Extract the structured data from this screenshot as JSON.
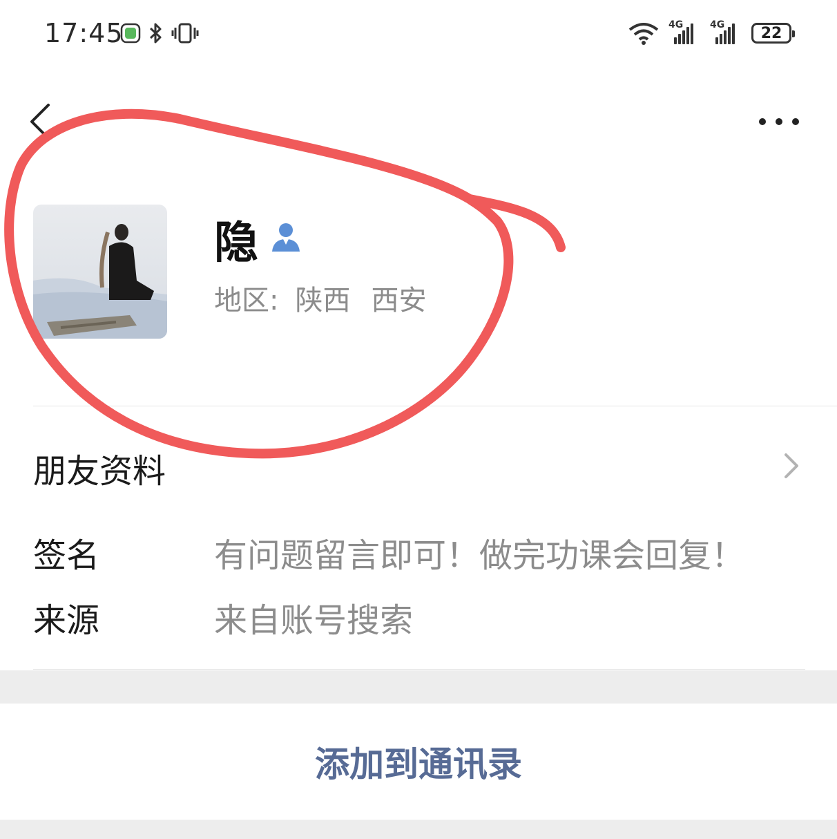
{
  "status_bar": {
    "time": "17:45",
    "battery": "22",
    "network_label_1": "4G",
    "network_label_2": "4G",
    "icons": [
      "wechat-notification-icon",
      "bluetooth-icon",
      "vibrate-icon",
      "wifi-icon",
      "signal-icon",
      "signal-icon",
      "battery-icon"
    ]
  },
  "nav": {
    "back_icon": "chevron-left-icon",
    "more_icon": "more-dots-icon"
  },
  "profile": {
    "nickname": "隐",
    "gender_icon": "user-icon",
    "region_label": "地区:",
    "region_province": "陕西",
    "region_city": "西安"
  },
  "rows": {
    "friend_info": "朋友资料",
    "signature_label": "签名",
    "signature_value": "有问题留言即可！做完功课会回复！",
    "source_label": "来源",
    "source_value": "来自账号搜索"
  },
  "actions": {
    "add_contact": "添加到通讯录"
  },
  "colors": {
    "link": "#576b95",
    "annotation": "#f05a5a",
    "secondary_text": "#8c8c8c",
    "band": "#ededed"
  }
}
